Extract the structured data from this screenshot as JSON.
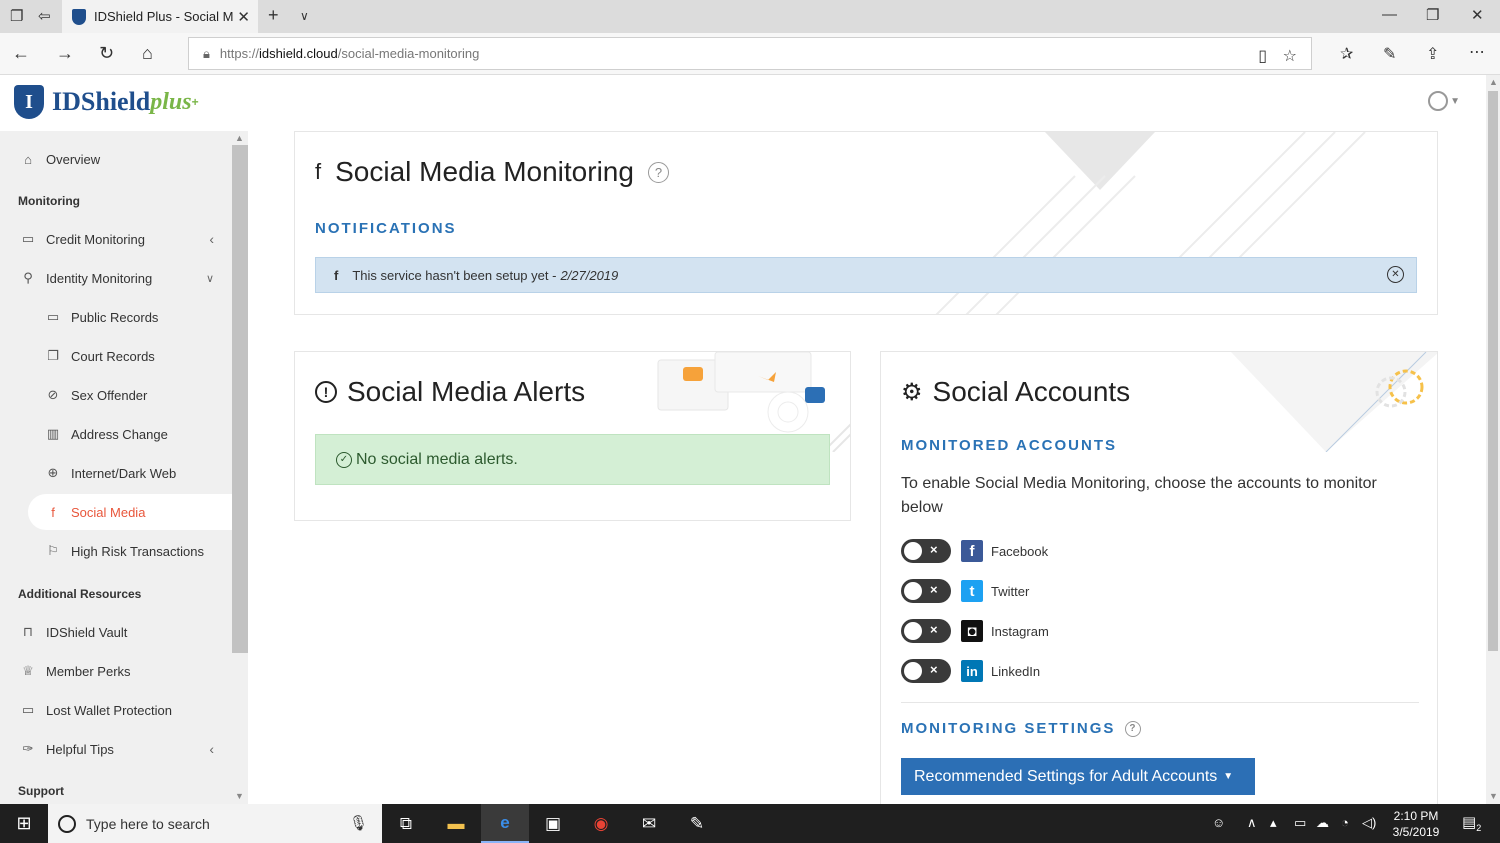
{
  "browser": {
    "tab_title": "IDShield Plus - Social M",
    "url_prefix": "https://",
    "url_domain": "idshield.cloud",
    "url_path": "/social-media-monitoring"
  },
  "brand": {
    "name": "IDShield",
    "suffix": "plus",
    "plus_mark": "+",
    "shield_letter": "I"
  },
  "sidebar": {
    "overview": "Overview",
    "monitoring_heading": "Monitoring",
    "credit_monitoring": "Credit Monitoring",
    "identity_monitoring": "Identity Monitoring",
    "public_records": "Public Records",
    "court_records": "Court Records",
    "sex_offender": "Sex Offender",
    "address_change": "Address Change",
    "internet_dark_web": "Internet/Dark Web",
    "social_media": "Social Media",
    "high_risk": "High Risk Transactions",
    "additional_heading": "Additional Resources",
    "vault": "IDShield Vault",
    "member_perks": "Member Perks",
    "lost_wallet": "Lost Wallet Protection",
    "helpful_tips": "Helpful Tips",
    "support_heading": "Support"
  },
  "monitoring_card": {
    "title": "Social Media Monitoring",
    "notifications_label": "NOTIFICATIONS",
    "notification_text": "This service hasn't been setup yet -",
    "notification_date": "2/27/2019"
  },
  "alerts_card": {
    "title": "Social Media Alerts",
    "empty_message": "No social media alerts."
  },
  "accounts_card": {
    "title": "Social Accounts",
    "monitored_label": "MONITORED ACCOUNTS",
    "intro": "To enable Social Media Monitoring, choose the accounts to monitor below",
    "accounts": [
      {
        "name": "Facebook",
        "color": "#3b5998",
        "glyph": "f"
      },
      {
        "name": "Twitter",
        "color": "#1da1f2",
        "glyph": "t"
      },
      {
        "name": "Instagram",
        "color": "#111111",
        "glyph": "◘"
      },
      {
        "name": "LinkedIn",
        "color": "#0077b5",
        "glyph": "in"
      }
    ],
    "toggle_off_mark": "×",
    "settings_label": "MONITORING SETTINGS",
    "settings_button": "Recommended Settings for Adult Accounts"
  },
  "taskbar": {
    "search_placeholder": "Type here to search",
    "time": "2:10 PM",
    "date": "3/5/2019",
    "notification_count": "2"
  },
  "colors": {
    "accent_blue": "#2a72b5",
    "active_orange": "#e8563b",
    "success_bg": "#d4efd5",
    "info_bg": "#d3e3f1"
  }
}
